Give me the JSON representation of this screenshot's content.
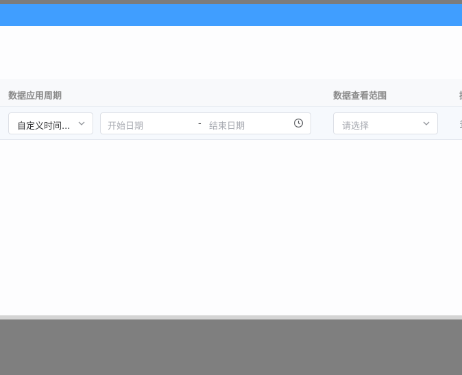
{
  "table": {
    "headers": {
      "period": "数据应用周期",
      "scope": "数据查看范围",
      "next": "操"
    },
    "row": {
      "period_type": {
        "value": "自定义时间..."
      },
      "date_range": {
        "start_placeholder": "开始日期",
        "separator": "-",
        "end_placeholder": "结束日期"
      },
      "scope_select": {
        "placeholder": "请选择"
      },
      "next_cell": "多"
    }
  },
  "colors": {
    "header_bar": "#409eff"
  }
}
